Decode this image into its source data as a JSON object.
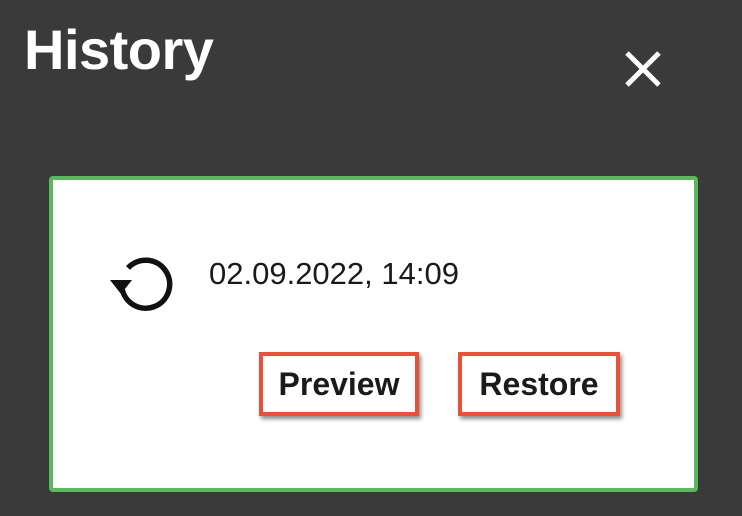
{
  "header": {
    "title": "History",
    "close_icon": "close-icon"
  },
  "history_entry": {
    "icon": "restore-history-icon",
    "timestamp": "02.09.2022, 14:09",
    "preview_label": "Preview",
    "restore_label": "Restore"
  },
  "colors": {
    "background": "#3a3a3a",
    "card_border": "#5cb85c",
    "highlight_border": "#e8503a"
  }
}
